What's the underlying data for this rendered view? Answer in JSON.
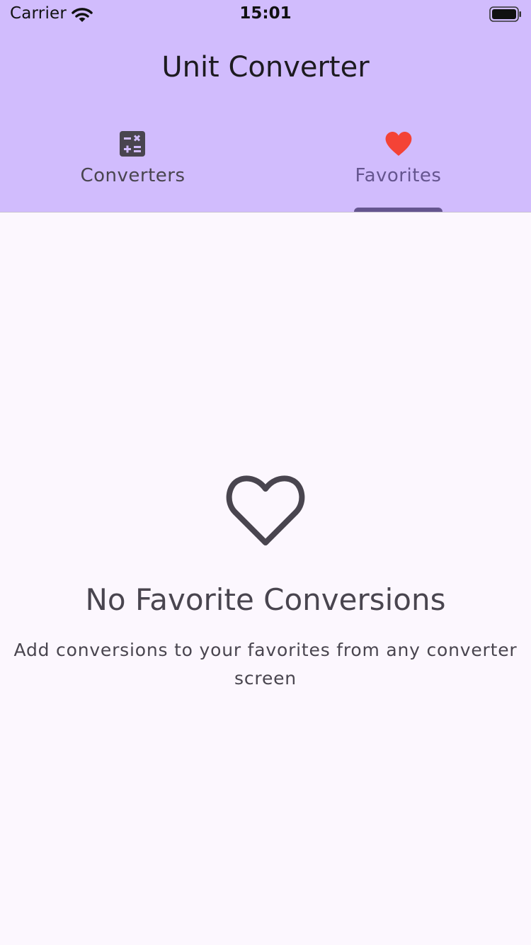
{
  "status_bar": {
    "carrier": "Carrier",
    "time": "15:01",
    "wifi_icon": "wifi-icon",
    "battery_icon": "battery-icon"
  },
  "app_bar": {
    "title": "Unit Converter",
    "background_color": "#d1bcfd"
  },
  "tabs": [
    {
      "label": "Converters",
      "icon": "calculator-icon",
      "selected": false
    },
    {
      "label": "Favorites",
      "icon": "heart-filled-icon",
      "selected": true,
      "icon_color": "#f44336"
    }
  ],
  "empty_state": {
    "icon": "heart-outline-icon",
    "title": "No Favorite Conversions",
    "message": "Add conversions to your favorites from any converter screen"
  },
  "colors": {
    "accent": "#65558f",
    "page_background": "#fcf7fe",
    "text": "#49454f"
  }
}
